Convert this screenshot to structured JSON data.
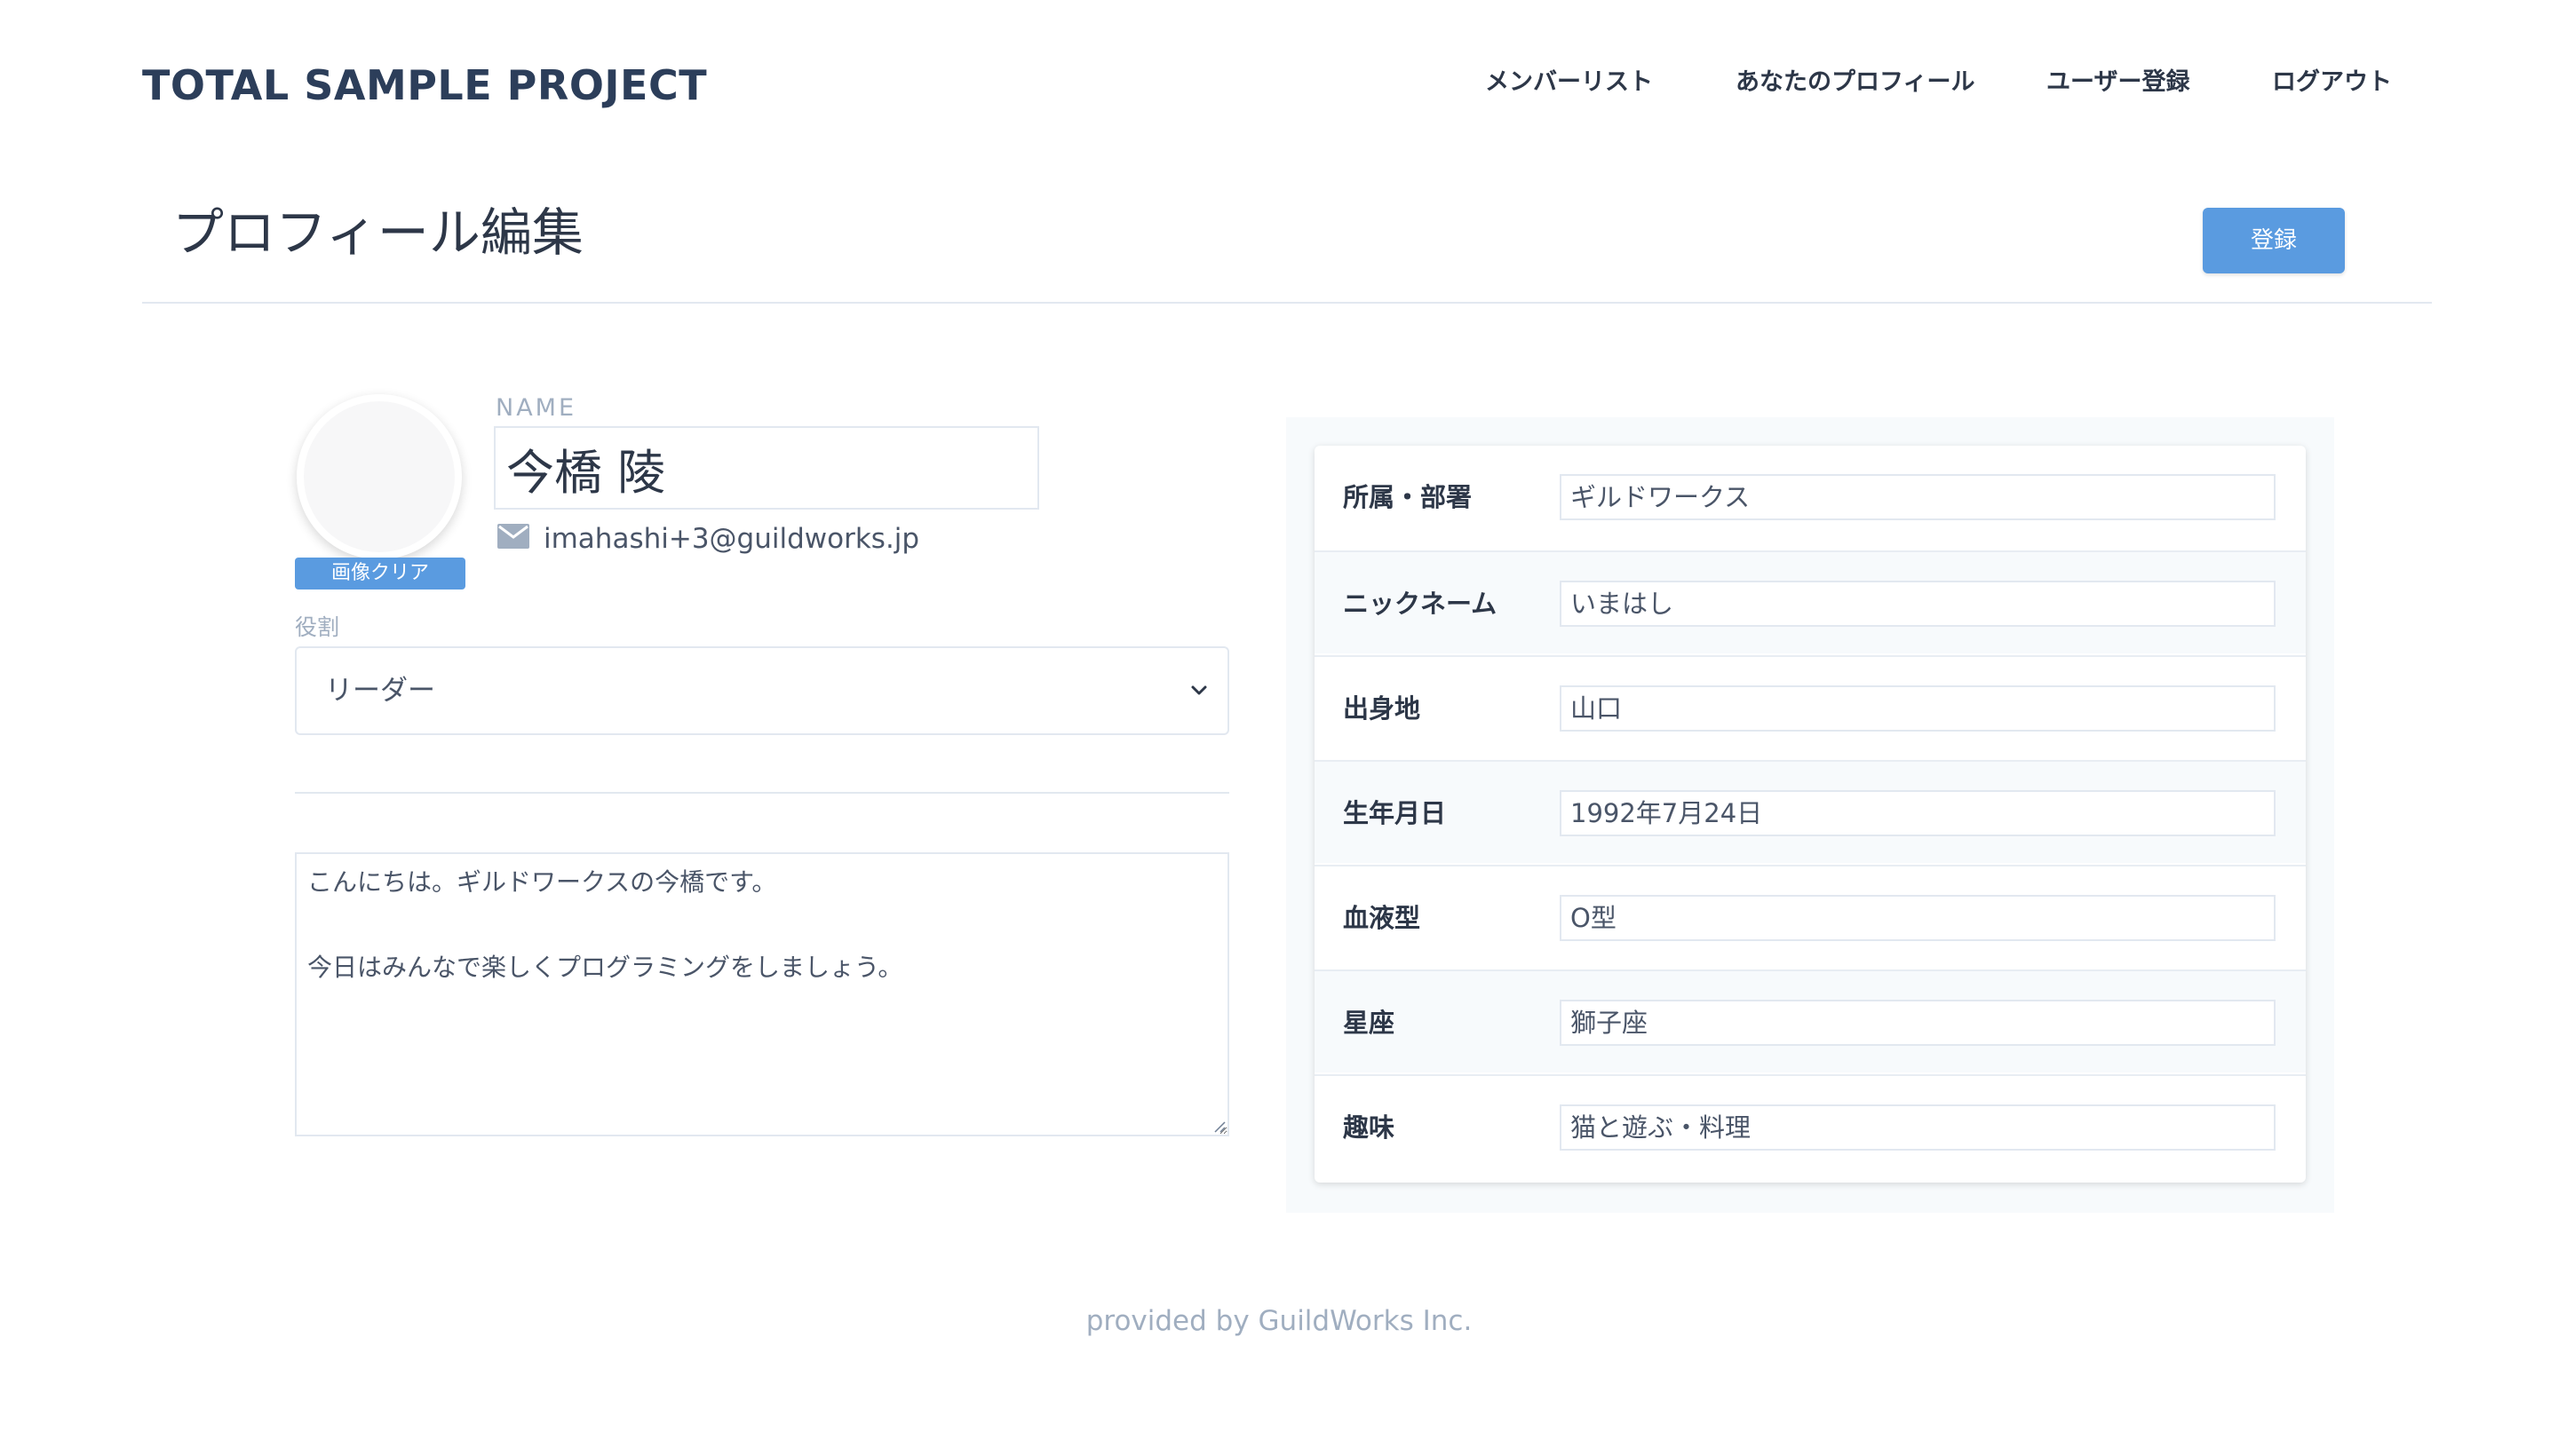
{
  "header": {
    "brand": "TOTAL SAMPLE PROJECT",
    "nav": [
      {
        "label": "メンバーリスト"
      },
      {
        "label": "あなたのプロフィール"
      },
      {
        "label": "ユーザー登録"
      },
      {
        "label": "ログアウト"
      }
    ]
  },
  "page": {
    "title": "プロフィール編集",
    "register_label": "登録"
  },
  "profile": {
    "clear_image_label": "画像クリア",
    "name_label": "NAME",
    "name_value": "今橋 陵",
    "email": "imahashi+3@guildworks.jp",
    "role_label": "役割",
    "role_value": "リーダー",
    "bio_lines": [
      "こんにちは。ギルドワークスの今橋です。",
      "",
      "今日はみんなで楽しくプログラミングをしましょう。"
    ]
  },
  "details": {
    "rows": [
      {
        "label": "所属・部署",
        "value": "ギルドワークス"
      },
      {
        "label": "ニックネーム",
        "value": "いまはし"
      },
      {
        "label": "出身地",
        "value": "山口"
      },
      {
        "label": "生年月日",
        "value": "1992年7月24日"
      },
      {
        "label": "血液型",
        "value": "O型"
      },
      {
        "label": "星座",
        "value": "獅子座"
      },
      {
        "label": "趣味",
        "value": "猫と遊ぶ・料理"
      }
    ]
  },
  "footer": {
    "text": "provided by GuildWorks Inc."
  },
  "colors": {
    "accent": "#5a9be0",
    "brand_text": "#2c3e5a",
    "muted": "#a0aec0",
    "border": "#e2e8f0",
    "panel_bg": "#f7fafc"
  },
  "icons": {
    "mail": "mail-icon",
    "select_arrow": "chevron-down-icon"
  }
}
